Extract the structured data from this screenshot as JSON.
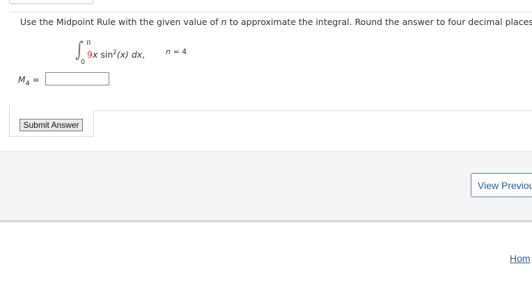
{
  "question": {
    "text_before_n": "Use the Midpoint Rule with the given value of",
    "n_symbol": "n",
    "text_after_n": "to approximate the integral. Round the answer to four decimal places."
  },
  "integral": {
    "upper_limit": "π",
    "lower_limit": "0",
    "coefficient": "9",
    "var_x": "x",
    "func": "sin",
    "exponent": "2",
    "argument": "(x)",
    "dx": "dx",
    "trailing_comma": ","
  },
  "n_value": {
    "symbol": "n",
    "text": "= 4"
  },
  "answer": {
    "label_letter": "M",
    "label_subscript": "4",
    "label_equals": "=",
    "input_value": ""
  },
  "buttons": {
    "submit_label": "Submit Answer",
    "view_previous_label": "View Previou"
  },
  "links": {
    "home_label": "Hom"
  },
  "colors": {
    "coefficient": "#c0392b",
    "link": "#2a5d8c"
  }
}
